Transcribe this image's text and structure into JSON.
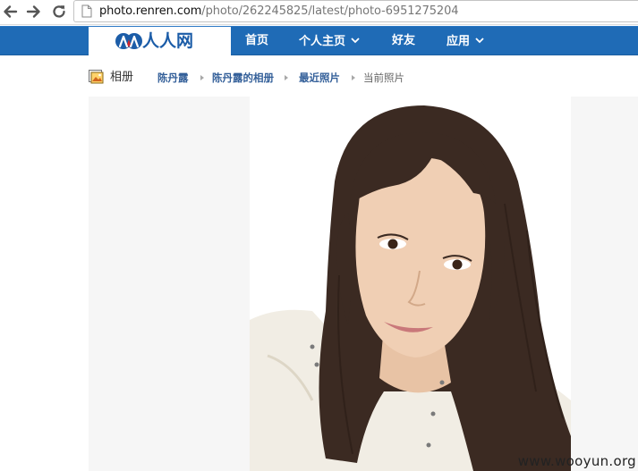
{
  "browser": {
    "url_host": "photo.renren.com",
    "url_path": "/photo/262245825/latest/photo-6951275204",
    "icons": [
      "back-arrow-icon",
      "forward-arrow-icon",
      "reload-icon",
      "page-icon"
    ]
  },
  "site": {
    "logo_text": "人人网",
    "nav": [
      {
        "label": "首页"
      },
      {
        "label": "个人主页"
      },
      {
        "label": "好友"
      },
      {
        "label": "应用"
      }
    ],
    "colors": {
      "header": "#1f6bb6",
      "logo": "#1c5da8",
      "link": "#335f99"
    }
  },
  "breadcrumb": {
    "title": "相册",
    "items": [
      {
        "label": "陈丹露"
      },
      {
        "label": "陈丹露的相册"
      },
      {
        "label": "最近照片"
      },
      {
        "label": "当前照片"
      }
    ]
  },
  "watermark": "www.wooyun.org"
}
